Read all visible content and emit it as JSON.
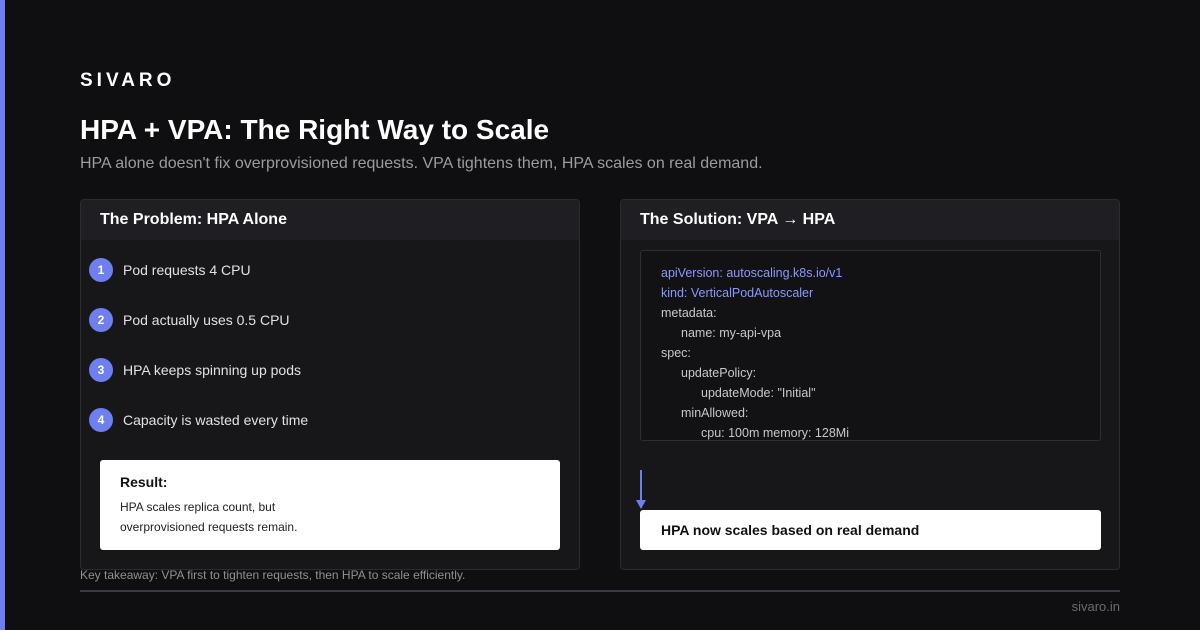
{
  "brand": "SIVARO",
  "title": "HPA + VPA: The Right Way to Scale",
  "subtitle": "HPA alone doesn't fix overprovisioned requests. VPA tightens them, HPA scales on real demand.",
  "problem": {
    "header": "The Problem: HPA Alone",
    "steps": [
      {
        "num": "1",
        "text": "Pod requests 4 CPU"
      },
      {
        "num": "2",
        "text": "Pod actually uses 0.5 CPU"
      },
      {
        "num": "3",
        "text": "HPA keeps spinning up pods"
      },
      {
        "num": "4",
        "text": "Capacity is wasted every time"
      }
    ],
    "result_title": "Result:",
    "result_text": "HPA scales replica count, but overprovisioned requests remain."
  },
  "solution": {
    "header": "The Solution: VPA → HPA",
    "code": [
      "apiVersion: autoscaling.k8s.io/v1",
      "kind: VerticalPodAutoscaler",
      "metadata:",
      "name: my-api-vpa",
      "spec:",
      "updatePolicy:",
      "updateMode: \"Initial\"",
      "minAllowed:",
      "cpu: 100m memory: 128Mi"
    ],
    "outcome": "HPA now scales based on real demand"
  },
  "footer": {
    "takeaway": "Key takeaway: VPA first to tighten requests, then HPA to scale efficiently.",
    "site": "sivaro.in"
  },
  "colors": {
    "accent": "#6f7ff0",
    "background": "#0f0f11",
    "code_keyword": "#8c98ff"
  }
}
